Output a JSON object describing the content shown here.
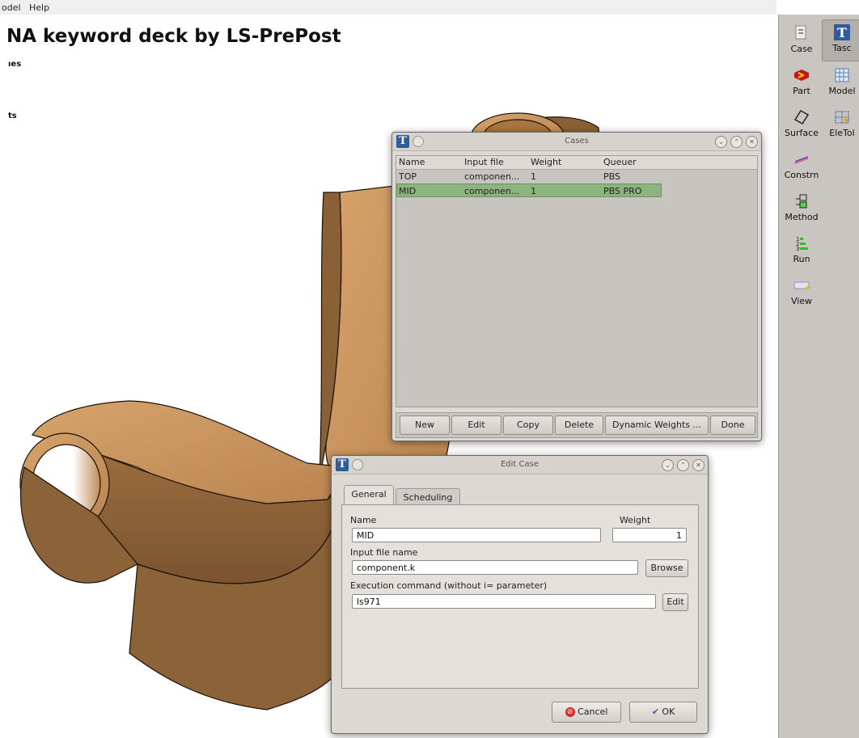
{
  "menubar": {
    "items": [
      "odel",
      "Help"
    ]
  },
  "document": {
    "title": "NA keyword deck by LS-PrePost",
    "fragments": [
      "ıes",
      "ts"
    ]
  },
  "right_panel": {
    "buttons": [
      {
        "label": "Case",
        "icon": "case-icon",
        "active": false
      },
      {
        "label": "Tasc",
        "icon": "tasc-icon",
        "active": true
      },
      {
        "label": "Part",
        "icon": "part-icon"
      },
      {
        "label": "Model",
        "icon": "model-icon"
      },
      {
        "label": "Surface",
        "icon": "surface-icon"
      },
      {
        "label": "EleTol",
        "icon": "eletol-icon"
      },
      {
        "label": "Constrn",
        "icon": "constraint-icon"
      },
      {
        "label": "Method",
        "icon": "method-icon"
      },
      {
        "label": "Run",
        "icon": "run-icon"
      },
      {
        "label": "View",
        "icon": "view-icon"
      }
    ]
  },
  "cases_window": {
    "title": "Cases",
    "columns": [
      "Name",
      "Input file",
      "Weight",
      "Queuer"
    ],
    "rows": [
      {
        "name": "TOP",
        "input": "componen...",
        "weight": "1",
        "queuer": "PBS"
      },
      {
        "name": "MID",
        "input": "componen...",
        "weight": "1",
        "queuer": "PBS PRO"
      }
    ],
    "buttons": {
      "new": "New",
      "edit": "Edit",
      "copy": "Copy",
      "delete": "Delete",
      "dynamic": "Dynamic Weights ...",
      "done": "Done"
    }
  },
  "edit_window": {
    "title": "Edit Case",
    "tabs": {
      "general": "General",
      "scheduling": "Scheduling"
    },
    "name_label": "Name",
    "name_value": "MID",
    "weight_label": "Weight",
    "weight_value": "1",
    "input_label": "Input file name",
    "input_value": "component.k",
    "browse": "Browse",
    "exec_label": "Execution command (without i= parameter)",
    "exec_value": "ls971",
    "exec_edit": "Edit",
    "cancel": "Cancel",
    "ok": "OK"
  },
  "colors": {
    "part_fill": "#8c6238",
    "part_light": "#d09a63",
    "selection": "#8db37f",
    "accent_blue": "#2f5c9b"
  }
}
